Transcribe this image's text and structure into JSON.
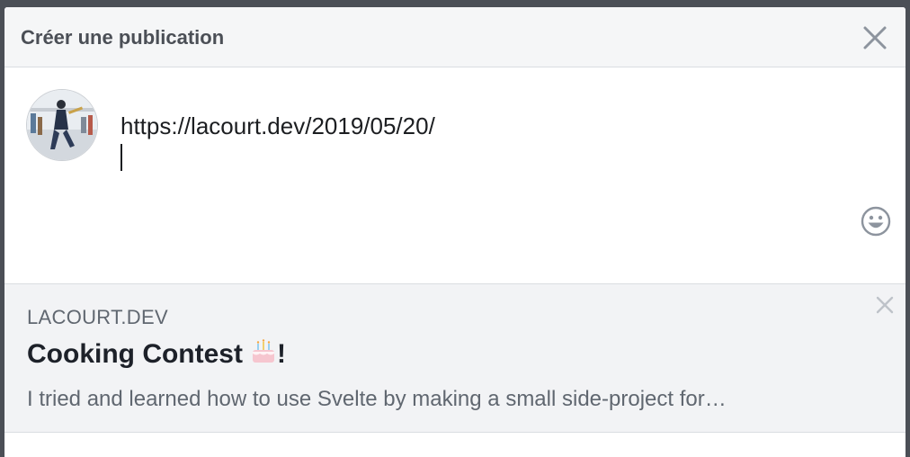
{
  "dialog": {
    "title": "Créer une publication",
    "close_icon": "close-icon"
  },
  "composer": {
    "text": "https://lacourt.dev/2019/05/20/",
    "avatar_icon": "avatar",
    "emoji_icon": "emoji-icon"
  },
  "link_preview": {
    "domain": "LACOURT.DEV",
    "title": "Cooking Contest",
    "title_suffix": "!",
    "description": "I tried and learned how to use Svelte by making a small side-project for…",
    "remove_icon": "close-icon",
    "title_emoji": "birthday-cake"
  },
  "colors": {
    "header_bg": "#f5f6f7",
    "preview_bg": "#f2f3f5",
    "text_dark": "#1c1e21",
    "text_muted": "#606770",
    "overlay": "#4b4f56"
  }
}
